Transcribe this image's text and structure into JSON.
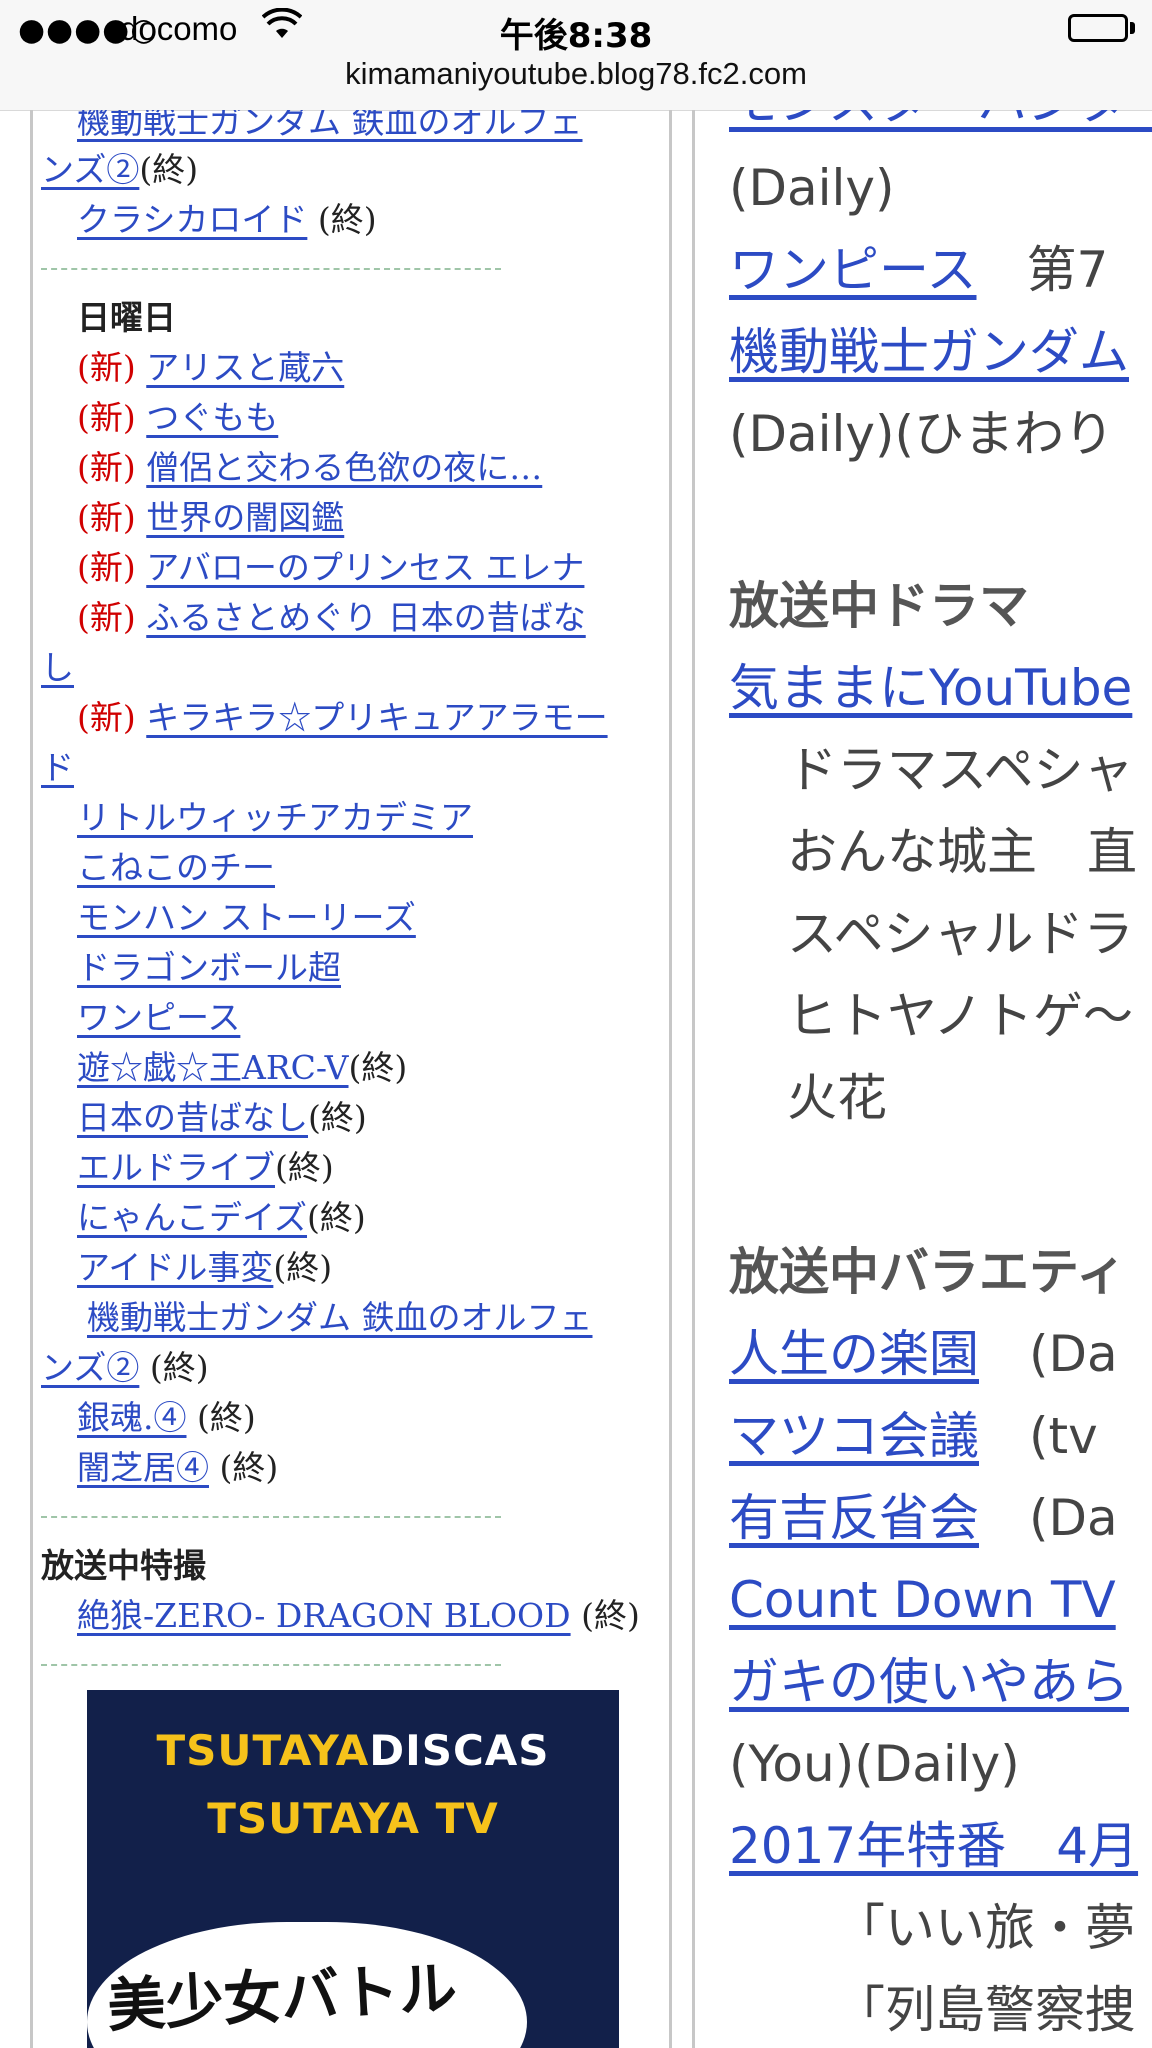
{
  "status_bar": {
    "signal": "●●●●○",
    "carrier": "docomo",
    "time": "午後8:38",
    "url": "kimamaniyoutube.blog78.fc2.com"
  },
  "left": {
    "top_item": {
      "link_a": "機動戦士ガンダム 鉄血のオルフェ",
      "link_b": "ンズ②",
      "suffix": "(終)"
    },
    "item_classicaloid": {
      "link": "クラシカロイド",
      "suffix": " (終)"
    },
    "sunday_heading": "日曜日",
    "new_tag": "(新)",
    "end_tag": "(終)",
    "new_items": [
      "アリスと蔵六",
      "つぐもも",
      "僧侶と交わる色欲の夜に…",
      "世界の闇図鑑",
      "アバローのプリンセス エレナ"
    ],
    "furusato": {
      "link_a": "ふるさとめぐり 日本の昔ばな",
      "link_b": "し"
    },
    "kirakira": {
      "link_a": "キラキラ☆プリキュアアラモー",
      "link_b": "ド"
    },
    "items": [
      "リトルウィッチアカデミア",
      "こねこのチー",
      "モンハン ストーリーズ",
      "ドラゴンボール超",
      "ワンピース"
    ],
    "ended_items": [
      "遊☆戯☆王ARC-V",
      "日本の昔ばなし",
      "エルドライブ",
      "にゃんこデイズ",
      "アイドル事変"
    ],
    "gundam2": {
      "link_a": "機動戦士ガンダム 鉄血のオルフェ",
      "link_b": "ンズ②",
      "suffix": " (終)"
    },
    "gintama": {
      "link": "銀魂.④",
      "suffix": " (終)"
    },
    "yamishibai": {
      "link": "闇芝居④",
      "suffix": " (終)"
    },
    "tokusatsu_heading": "放送中特撮",
    "garo": {
      "link": "絶狼-ZERO- DRAGON BLOOD",
      "suffix": " (終)"
    },
    "ad": {
      "line1_yellow": "TSUTAYA",
      "line1_white": "DISCAS",
      "line2": "TSUTAYA TV",
      "bubble": "美少女バトル"
    }
  },
  "right": {
    "top_partial_link": "モンスターハンター",
    "daily1": "(Daily)",
    "onepiece": {
      "link": "ワンピース",
      "suffix": "　第7"
    },
    "gundam_link": "機動戦士ガンダム",
    "daily_himawari": "(Daily)(ひまわり",
    "drama_heading": "放送中ドラマ",
    "kimama_link": "気ままにYouTube",
    "drama_items": [
      "ドラマスペシャ",
      "おんな城主　直",
      "スペシャルドラ",
      "ヒトヤノトゲ〜",
      "火花"
    ],
    "variety_heading": "放送中バラエティ",
    "jinsei": {
      "link": "人生の楽園",
      "suffix": "　(Da"
    },
    "matsuko": {
      "link": "マツコ会議",
      "suffix": "　(tv"
    },
    "ariyoshi": {
      "link": "有吉反省会",
      "suffix": "　(Da"
    },
    "countdown_link": "Count Down TV",
    "gaki_link": "ガキの使いやあら",
    "you_daily": "(You)(Daily)",
    "tokuban": {
      "link": "2017年特番　4月"
    },
    "sub_items": [
      "「いい旅・夢",
      "「列島警察捜"
    ]
  }
}
